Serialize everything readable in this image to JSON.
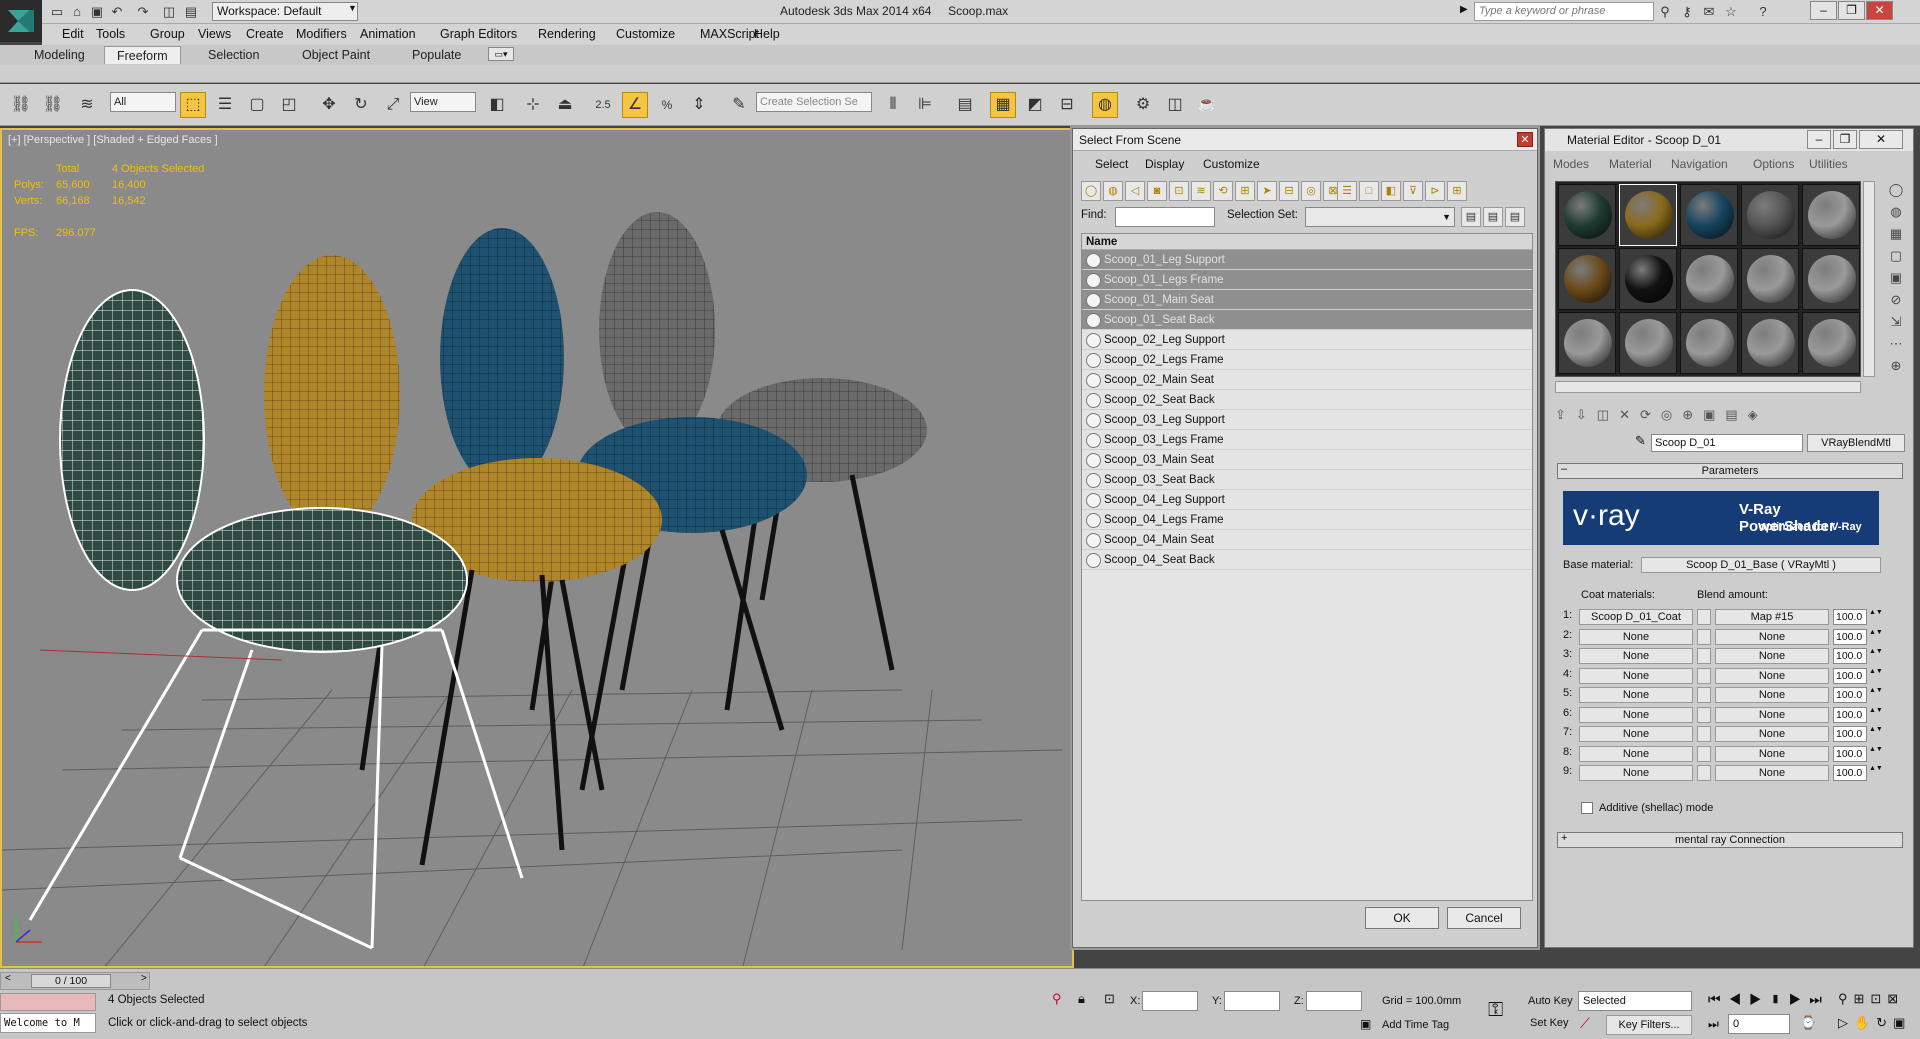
{
  "app": {
    "title": "Autodesk 3ds Max  2014 x64",
    "file": "Scoop.max",
    "workspace": "Workspace: Default",
    "search_placeholder": "Type a keyword or phrase"
  },
  "menu": [
    "Edit",
    "Tools",
    "Group",
    "Views",
    "Create",
    "Modifiers",
    "Animation",
    "Graph Editors",
    "Rendering",
    "Customize",
    "MAXScript",
    "Help"
  ],
  "ribbon_tabs": [
    "Modeling",
    "Freeform",
    "Selection",
    "Object Paint",
    "Populate"
  ],
  "toolbar": {
    "filter": "All",
    "ref_coord": "View",
    "snap_value": "2.5",
    "selection_set_placeholder": "Create Selection Se"
  },
  "viewport": {
    "label": "[+] [Perspective ] [Shaded + Edged Faces ]",
    "stats": {
      "total_label": "Total",
      "selected_label": "4 Objects Selected",
      "polys_label": "Polys:",
      "polys_total": "65,600",
      "polys_sel": "16,400",
      "verts_label": "Verts:",
      "verts_total": "66,168",
      "verts_sel": "16,542",
      "fps_label": "FPS:",
      "fps": "296.077"
    },
    "chairs": [
      {
        "color": "#2f4a42"
      },
      {
        "color": "#b0862a"
      },
      {
        "color": "#1e5270"
      },
      {
        "color": "#6a6a6a"
      }
    ]
  },
  "select_dialog": {
    "title": "Select From Scene",
    "menus": [
      "Select",
      "Display",
      "Customize"
    ],
    "find_label": "Find:",
    "selection_set_label": "Selection Set:",
    "column_name": "Name",
    "items": [
      {
        "name": "Scoop_01_Leg Support",
        "selected": true
      },
      {
        "name": "Scoop_01_Legs Frame",
        "selected": true
      },
      {
        "name": "Scoop_01_Main Seat",
        "selected": true
      },
      {
        "name": "Scoop_01_Seat Back",
        "selected": true
      },
      {
        "name": "Scoop_02_Leg Support",
        "selected": false
      },
      {
        "name": "Scoop_02_Legs Frame",
        "selected": false
      },
      {
        "name": "Scoop_02_Main Seat",
        "selected": false
      },
      {
        "name": "Scoop_02_Seat Back",
        "selected": false
      },
      {
        "name": "Scoop_03_Leg Support",
        "selected": false
      },
      {
        "name": "Scoop_03_Legs Frame",
        "selected": false
      },
      {
        "name": "Scoop_03_Main Seat",
        "selected": false
      },
      {
        "name": "Scoop_03_Seat Back",
        "selected": false
      },
      {
        "name": "Scoop_04_Leg Support",
        "selected": false
      },
      {
        "name": "Scoop_04_Legs Frame",
        "selected": false
      },
      {
        "name": "Scoop_04_Main Seat",
        "selected": false
      },
      {
        "name": "Scoop_04_Seat Back",
        "selected": false
      }
    ],
    "ok": "OK",
    "cancel": "Cancel"
  },
  "material_editor": {
    "title": "Material Editor - Scoop D_01",
    "menus": [
      "Modes",
      "Material",
      "Navigation",
      "Options",
      "Utilities"
    ],
    "material_name": "Scoop D_01",
    "material_type": "VRayBlendMtl",
    "rollout_parameters": "Parameters",
    "banner_logo": "v·ray",
    "banner_title": "V-Ray PowerShader",
    "banner_sub": "optimized for V-Ray",
    "base_label": "Base material:",
    "base_value": "Scoop D_01_Base  ( VRayMtl )",
    "coat_label": "Coat materials:",
    "blend_label": "Blend amount:",
    "coats": [
      {
        "idx": "1:",
        "coat": "Scoop D_01_Coat",
        "blend": "Map #15",
        "amt": "100.0"
      },
      {
        "idx": "2:",
        "coat": "None",
        "blend": "None",
        "amt": "100.0"
      },
      {
        "idx": "3:",
        "coat": "None",
        "blend": "None",
        "amt": "100.0"
      },
      {
        "idx": "4:",
        "coat": "None",
        "blend": "None",
        "amt": "100.0"
      },
      {
        "idx": "5:",
        "coat": "None",
        "blend": "None",
        "amt": "100.0"
      },
      {
        "idx": "6:",
        "coat": "None",
        "blend": "None",
        "amt": "100.0"
      },
      {
        "idx": "7:",
        "coat": "None",
        "blend": "None",
        "amt": "100.0"
      },
      {
        "idx": "8:",
        "coat": "None",
        "blend": "None",
        "amt": "100.0"
      },
      {
        "idx": "9:",
        "coat": "None",
        "blend": "None",
        "amt": "100.0"
      }
    ],
    "additive_label": "Additive (shellac) mode",
    "mentalray_label": "mental ray Connection",
    "slot_colors": [
      "#1f3b33",
      "#8a6a1c",
      "#174560",
      "#555555",
      "#9a9a9a",
      "#6b4a1a",
      "#111111",
      "#9a9a9a",
      "#9a9a9a",
      "#9a9a9a",
      "#9a9a9a",
      "#9a9a9a",
      "#9a9a9a",
      "#9a9a9a",
      "#9a9a9a"
    ]
  },
  "status": {
    "timeline": "0 / 100",
    "maxscript": "Welcome to M",
    "selected": "4 Objects Selected",
    "prompt": "Click or click-and-drag to select objects",
    "x_label": "X:",
    "y_label": "Y:",
    "z_label": "Z:",
    "grid": "Grid = 100.0mm",
    "add_time_tag": "Add Time Tag",
    "auto_key": "Auto Key",
    "set_key": "Set Key",
    "key_mode": "Selected",
    "key_filters": "Key Filters...",
    "frame": "0"
  }
}
